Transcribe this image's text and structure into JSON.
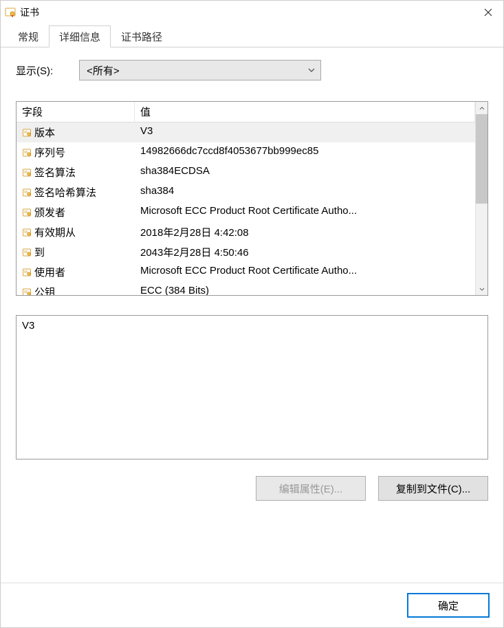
{
  "window": {
    "title": "证书",
    "close_icon": "close"
  },
  "tabs": [
    {
      "label": "常规",
      "active": false
    },
    {
      "label": "详细信息",
      "active": true
    },
    {
      "label": "证书路径",
      "active": false
    }
  ],
  "show": {
    "label": "显示(S):",
    "selected": "<所有>"
  },
  "listview": {
    "header_field": "字段",
    "header_value": "值",
    "rows": [
      {
        "field": "版本",
        "value": "V3",
        "selected": true
      },
      {
        "field": "序列号",
        "value": "14982666dc7ccd8f4053677bb999ec85",
        "selected": false
      },
      {
        "field": "签名算法",
        "value": "sha384ECDSA",
        "selected": false
      },
      {
        "field": "签名哈希算法",
        "value": "sha384",
        "selected": false
      },
      {
        "field": "颁发者",
        "value": "Microsoft ECC Product Root Certificate Autho...",
        "selected": false
      },
      {
        "field": "有效期从",
        "value": "2018年2月28日 4:42:08",
        "selected": false
      },
      {
        "field": "到",
        "value": "2043年2月28日 4:50:46",
        "selected": false
      },
      {
        "field": "使用者",
        "value": "Microsoft ECC Product Root Certificate Autho...",
        "selected": false
      },
      {
        "field": "公钥",
        "value": "ECC (384 Bits)",
        "selected": false
      }
    ]
  },
  "detail": {
    "text": "V3"
  },
  "buttons": {
    "edit_properties": "编辑属性(E)...",
    "copy_to_file": "复制到文件(C)...",
    "ok": "确定"
  }
}
